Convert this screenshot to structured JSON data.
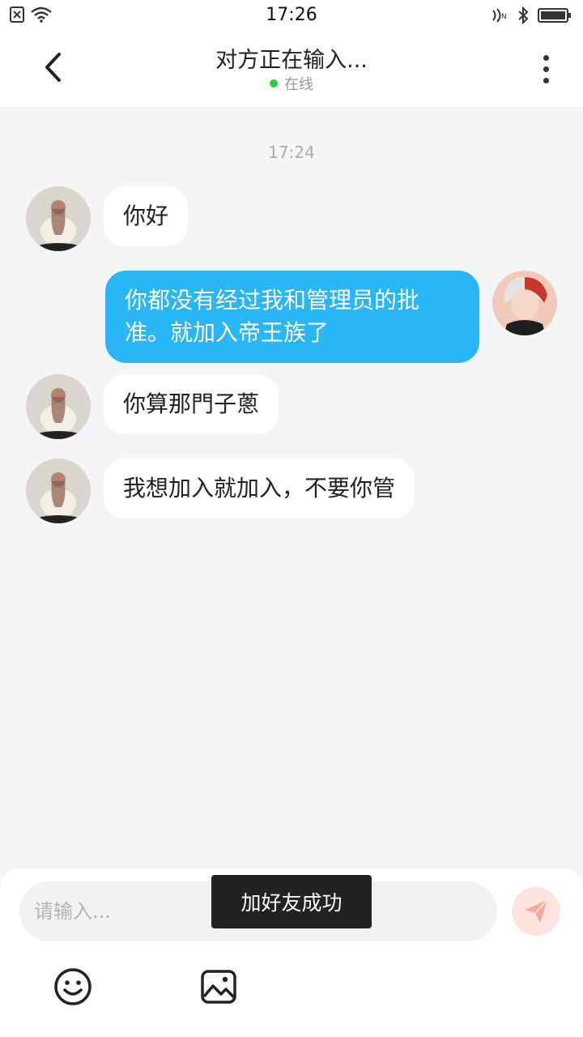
{
  "status_bar": {
    "time": "17:26",
    "left_icons": [
      "sim-error-icon",
      "wifi-icon"
    ],
    "right_icons": [
      "nfc-icon",
      "bluetooth-icon",
      "battery-icon"
    ]
  },
  "header": {
    "title": "对方正在输入...",
    "status": "在线",
    "status_color": "#2ecc40"
  },
  "chat": {
    "timestamp": "17:24",
    "messages": [
      {
        "direction": "in",
        "text": "你好"
      },
      {
        "direction": "out",
        "text": "你都没有经过我和管理员的批准。就加入帝王族了"
      },
      {
        "direction": "in",
        "text": "你算那門子蔥"
      },
      {
        "direction": "in",
        "text": "我想加入就加入，不要你管"
      }
    ],
    "outgoing_bubble_color": "#29b6f6"
  },
  "input": {
    "placeholder": "请输入..."
  },
  "toolbar": {
    "icons": [
      "emoji-icon",
      "image-icon"
    ],
    "send_icon": "send-icon"
  },
  "toast": {
    "text": "加好友成功"
  }
}
